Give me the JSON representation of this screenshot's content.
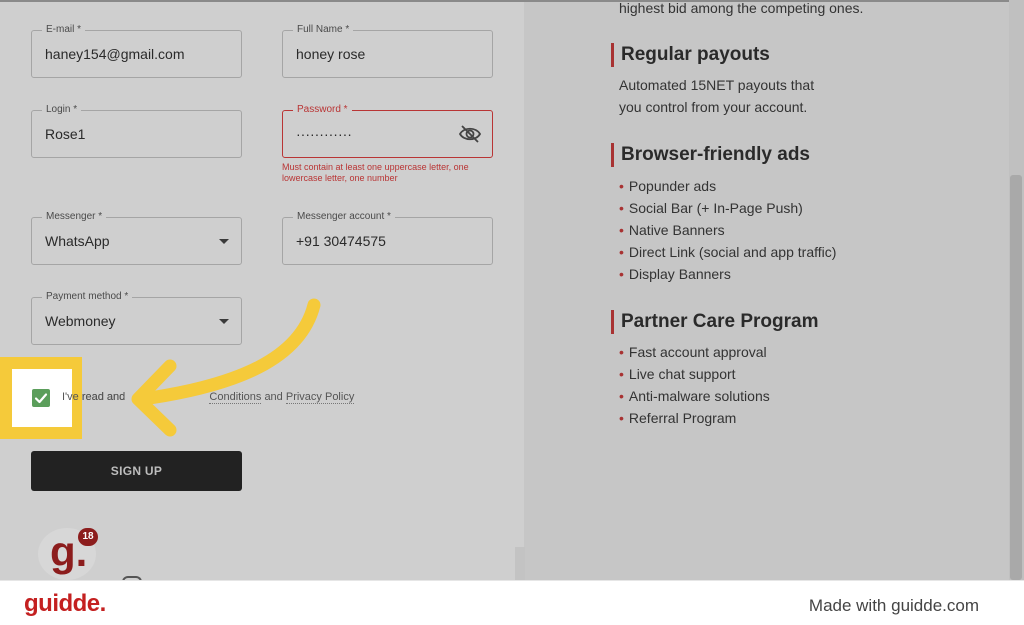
{
  "form": {
    "email": {
      "label": "E-mail *",
      "value": "haney154@gmail.com"
    },
    "full_name": {
      "label": "Full Name *",
      "value": "honey rose"
    },
    "login": {
      "label": "Login *",
      "value": "Rose1"
    },
    "password": {
      "label": "Password *",
      "value": "············",
      "error": "Must contain at least one uppercase letter, one lowercase letter, one number"
    },
    "messenger": {
      "label": "Messenger *",
      "value": "WhatsApp"
    },
    "messenger_account": {
      "label": "Messenger account *",
      "value": "+91 30474575"
    },
    "payment_method": {
      "label": "Payment method *",
      "value": "Webmoney"
    },
    "consent": {
      "prefix": "I've read and",
      "terms": "Conditions",
      "and": "and",
      "privacy": "Privacy Policy"
    },
    "signup_label": "SIGN UP",
    "avatar_badge": "18"
  },
  "right": {
    "top_line": "highest bid among the competing ones.",
    "payouts": {
      "heading": "Regular payouts",
      "line1": "Automated 15NET payouts that",
      "line2": "you control from your account."
    },
    "ads": {
      "heading": "Browser-friendly ads",
      "items": [
        "Popunder ads",
        "Social Bar (+ In-Page Push)",
        "Native Banners",
        "Direct Link (social and app traffic)",
        "Display Banners"
      ]
    },
    "partner": {
      "heading": "Partner Care Program",
      "items": [
        "Fast account approval",
        "Live chat support",
        "Anti-malware solutions",
        "Referral Program"
      ]
    }
  },
  "footer": {
    "logo": "guidde.",
    "made_with": "Made with guidde.com"
  },
  "colors": {
    "accent_red": "#a83232",
    "highlight_yellow": "#f5ca3a",
    "checkbox_green": "#5b9e5b",
    "button_dark": "#222222",
    "logo_red": "#c42020"
  }
}
